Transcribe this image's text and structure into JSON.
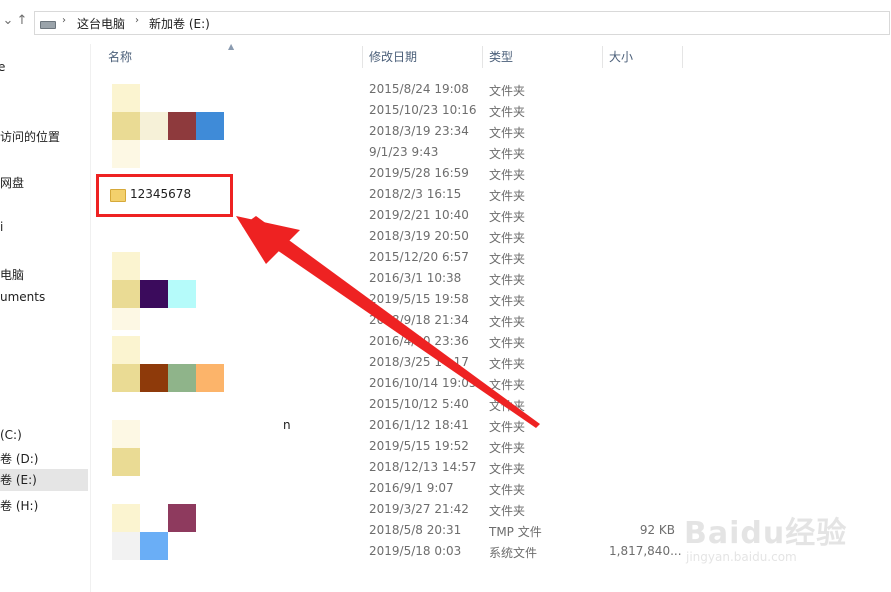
{
  "address_bar": {
    "crumbs": [
      "这台电脑",
      "新加卷 (E:)"
    ]
  },
  "sidebar": {
    "items": [
      "e",
      "访问的位置",
      "网盘",
      "i",
      "电脑",
      "uments",
      "(C:)",
      "卷 (D:)",
      "卷 (E:)",
      "卷 (H:)"
    ]
  },
  "columns": {
    "name": "名称",
    "modified": "修改日期",
    "type": "类型",
    "size": "大小"
  },
  "highlight_folder": "12345678",
  "stray_text": "n",
  "rows": [
    {
      "date": "2015/8/24 19:08",
      "type": "文件夹",
      "size": ""
    },
    {
      "date": "2015/10/23 10:16",
      "type": "文件夹",
      "size": ""
    },
    {
      "date": "2018/3/19 23:34",
      "type": "文件夹",
      "size": ""
    },
    {
      "date": "9/1/23 9:43",
      "type": "文件夹",
      "size": ""
    },
    {
      "date": "2019/5/28 16:59",
      "type": "文件夹",
      "size": ""
    },
    {
      "date": "2018/2/3 16:15",
      "type": "文件夹",
      "size": ""
    },
    {
      "date": "2019/2/21 10:40",
      "type": "文件夹",
      "size": ""
    },
    {
      "date": "2018/3/19 20:50",
      "type": "文件夹",
      "size": ""
    },
    {
      "date": "2015/12/20 6:57",
      "type": "文件夹",
      "size": ""
    },
    {
      "date": "2016/3/1 10:38",
      "type": "文件夹",
      "size": ""
    },
    {
      "date": "2019/5/15 19:58",
      "type": "文件夹",
      "size": ""
    },
    {
      "date": "2018/9/18 21:34",
      "type": "文件夹",
      "size": ""
    },
    {
      "date": "2016/4/30 23:36",
      "type": "文件夹",
      "size": ""
    },
    {
      "date": "2018/3/25 14:17",
      "type": "文件夹",
      "size": ""
    },
    {
      "date": "2016/10/14 19:05",
      "type": "文件夹",
      "size": ""
    },
    {
      "date": "2015/10/12 5:40",
      "type": "文件夹",
      "size": ""
    },
    {
      "date": "2016/1/12 18:41",
      "type": "文件夹",
      "size": ""
    },
    {
      "date": "2019/5/15 19:52",
      "type": "文件夹",
      "size": ""
    },
    {
      "date": "2018/12/13 14:57",
      "type": "文件夹",
      "size": ""
    },
    {
      "date": "2016/9/1 9:07",
      "type": "文件夹",
      "size": ""
    },
    {
      "date": "2019/3/27 21:42",
      "type": "文件夹",
      "size": ""
    },
    {
      "date": "2018/5/8 20:31",
      "type": "TMP 文件",
      "size": "92 KB"
    },
    {
      "date": "2019/5/18 0:03",
      "type": "系统文件",
      "size": "1,817,840..."
    }
  ],
  "watermark": {
    "main": "Baidu经验",
    "sub": "jingyan.baidu.com"
  },
  "colors": {
    "annotation_red": "#ee2222",
    "header_text": "#4c607a",
    "selected_bg": "#e5e5e5"
  }
}
